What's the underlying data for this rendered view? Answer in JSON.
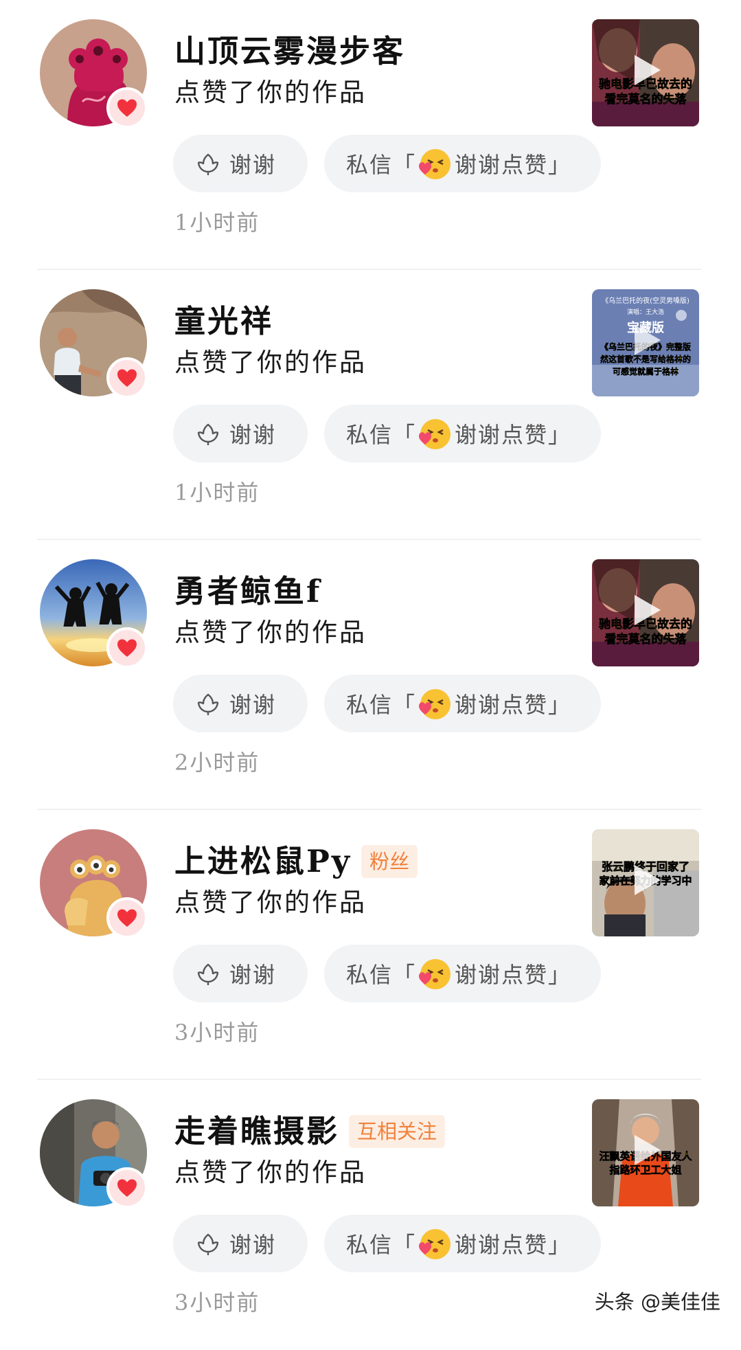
{
  "notifications": [
    {
      "username": "山顶云雾漫步客",
      "tag": "",
      "action": "点赞了你的作品",
      "thanks_label": "谢谢",
      "message_prefix": "私信「",
      "message_text": "谢谢点赞」",
      "time": "1小时前",
      "thumbnail_caption": [
        "驰电影早已故去的",
        "看完莫名的失落"
      ]
    },
    {
      "username": "童光祥",
      "tag": "",
      "action": "点赞了你的作品",
      "thanks_label": "谢谢",
      "message_prefix": "私信「",
      "message_text": "谢谢点赞」",
      "time": "1小时前",
      "thumbnail_caption": [
        "《乌兰巴托的夜(空灵男嗓版)",
        "演唱：王大浩",
        "宝藏版",
        "《乌兰巴托的夜》完整版",
        "然这首歌不是写给格林的",
        "可感觉就属于格林"
      ]
    },
    {
      "username": "勇者鲸鱼f",
      "tag": "",
      "action": "点赞了你的作品",
      "thanks_label": "谢谢",
      "message_prefix": "私信「",
      "message_text": "谢谢点赞」",
      "time": "2小时前",
      "thumbnail_caption": [
        "驰电影早已故去的",
        "看完莫名的失落"
      ]
    },
    {
      "username": "上进松鼠Py",
      "tag": "粉丝",
      "action": "点赞了你的作品",
      "thanks_label": "谢谢",
      "message_prefix": "私信「",
      "message_text": "谢谢点赞」",
      "time": "3小时前",
      "thumbnail_caption": [
        "张云鹏终于回家了",
        "家前在努力的学习中"
      ]
    },
    {
      "username": "走着瞧摄影",
      "tag": "互相关注",
      "action": "点赞了你的作品",
      "thanks_label": "谢谢",
      "message_prefix": "私信「",
      "message_text": "谢谢点赞」",
      "time": "3小时前",
      "thumbnail_caption": [
        "汪飘英语给外国友人",
        "指路环卫工大姐"
      ]
    }
  ],
  "watermark": "头条 @美佳佳",
  "colors": {
    "like_red": "#f1323c",
    "tag_orange": "#f0813a",
    "tag_bg": "#fdeee4",
    "button_bg": "#f2f3f5",
    "caption_yellow": "#ffe400"
  },
  "icons": {
    "like": "heart-icon",
    "thanks": "flower-icon",
    "message": "smile-kiss-emoji",
    "thumbnail": "play-icon"
  }
}
